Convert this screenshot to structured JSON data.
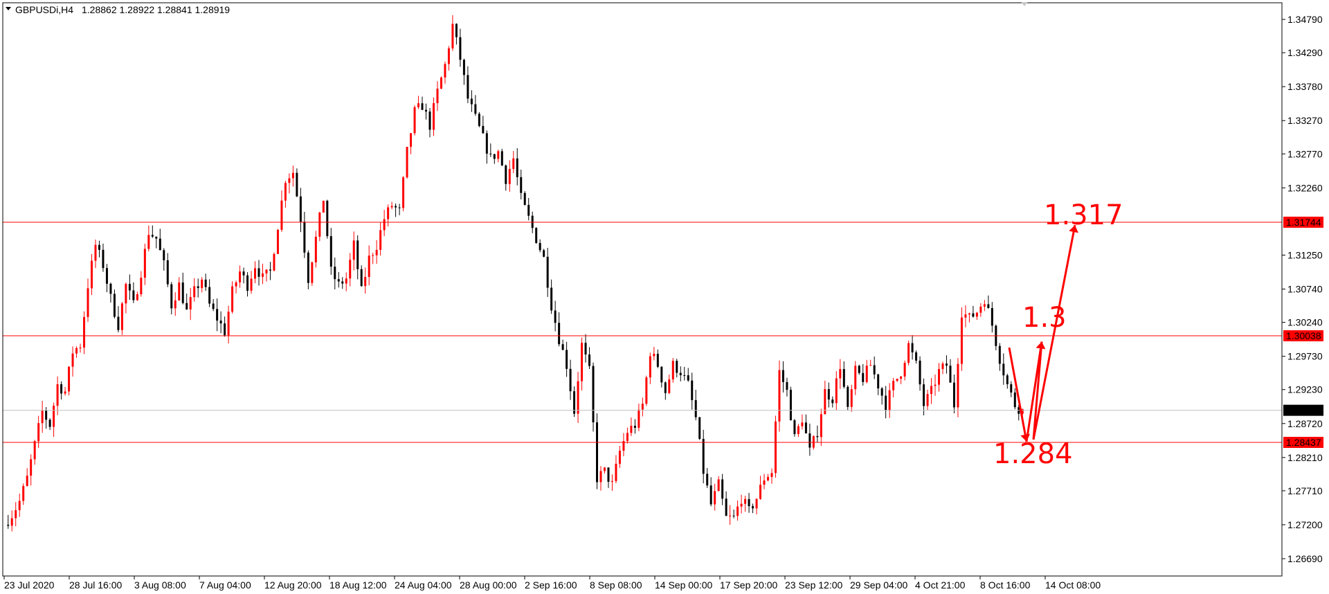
{
  "chart_data": {
    "type": "candlestick",
    "header": {
      "symbol": "GBPUSDi,H4",
      "ohlc": "1.28862 1.28922 1.28841 1.28919"
    },
    "ylim": [
      1.2643,
      1.3504
    ],
    "y_ticks": [
      "1.34790",
      "1.34290",
      "1.33780",
      "1.33270",
      "1.32770",
      "1.32260",
      "1.31250",
      "1.30740",
      "1.30240",
      "1.29730",
      "1.29230",
      "1.28720",
      "1.28210",
      "1.27710",
      "1.27200",
      "1.26690"
    ],
    "x_ticks": [
      "23 Jul 2020",
      "28 Jul 16:00",
      "3 Aug 08:00",
      "7 Aug 04:00",
      "12 Aug 20:00",
      "18 Aug 12:00",
      "24 Aug 04:00",
      "28 Aug 00:00",
      "2 Sep 16:00",
      "8 Sep 08:00",
      "14 Sep 00:00",
      "17 Sep 20:00",
      "23 Sep 12:00",
      "29 Sep 04:00",
      "4 Oct 21:00",
      "8 Oct 16:00",
      "14 Oct 08:00"
    ],
    "horizontal_lines": [
      {
        "value": 1.31744,
        "label": "1.31744",
        "color": "#ff0000"
      },
      {
        "value": 1.30038,
        "label": "1.30038",
        "color": "#ff0000"
      },
      {
        "value": 1.28437,
        "label": "1.28437",
        "color": "#ff0000"
      }
    ],
    "current_price": {
      "value": 1.28919,
      "label": "1.28919",
      "color": "#000000"
    },
    "price_path": [
      1.272,
      1.2735,
      1.2755,
      1.279,
      1.284,
      1.289,
      1.287,
      1.293,
      1.292,
      1.298,
      1.299,
      1.308,
      1.314,
      1.311,
      1.306,
      1.302,
      1.308,
      1.305,
      1.31,
      1.316,
      1.315,
      1.311,
      1.305,
      1.308,
      1.304,
      1.307,
      1.309,
      1.305,
      1.303,
      1.301,
      1.307,
      1.31,
      1.308,
      1.311,
      1.309,
      1.31,
      1.317,
      1.324,
      1.325,
      1.318,
      1.309,
      1.315,
      1.321,
      1.31,
      1.308,
      1.309,
      1.314,
      1.307,
      1.312,
      1.314,
      1.318,
      1.32,
      1.319,
      1.328,
      1.334,
      1.335,
      1.332,
      1.337,
      1.341,
      1.347,
      1.342,
      1.336,
      1.333,
      1.33,
      1.327,
      1.328,
      1.324,
      1.327,
      1.321,
      1.318,
      1.315,
      1.312,
      1.305,
      1.3,
      1.296,
      1.289,
      1.299,
      1.295,
      1.279,
      1.28,
      1.278,
      1.283,
      1.286,
      1.287,
      1.29,
      1.298,
      1.296,
      1.292,
      1.296,
      1.295,
      1.293,
      1.288,
      1.28,
      1.275,
      1.278,
      1.273,
      1.273,
      1.276,
      1.274,
      1.276,
      1.279,
      1.28,
      1.295,
      1.292,
      1.285,
      1.288,
      1.283,
      1.286,
      1.292,
      1.291,
      1.296,
      1.289,
      1.295,
      1.294,
      1.296,
      1.293,
      1.29,
      1.293,
      1.295,
      1.299,
      1.296,
      1.29,
      1.292,
      1.295,
      1.296,
      1.29,
      1.304,
      1.303,
      1.304,
      1.306,
      1.302,
      1.297,
      1.293,
      1.29,
      1.2891
    ],
    "annotations": [
      {
        "text": "1.317",
        "value": 1.3186,
        "color": "#ff0000"
      },
      {
        "text": "1.3",
        "value": 1.3032,
        "color": "#ff0000"
      },
      {
        "text": "1.284",
        "value": 1.2827,
        "color": "#ff0000"
      }
    ],
    "projection_path": [
      {
        "price": 1.289,
        "bar": 145
      },
      {
        "price": 1.2845,
        "bar": 147
      },
      {
        "price": 1.2995,
        "bar": 150
      },
      {
        "price": 1.2845,
        "bar": 148
      },
      {
        "price": 1.3175,
        "bar": 155
      }
    ],
    "colors": {
      "bull": "#ff0000",
      "bear": "#000000",
      "level": "#ff0000",
      "current": "#c0c0c0",
      "annotation": "#ff0000"
    }
  }
}
